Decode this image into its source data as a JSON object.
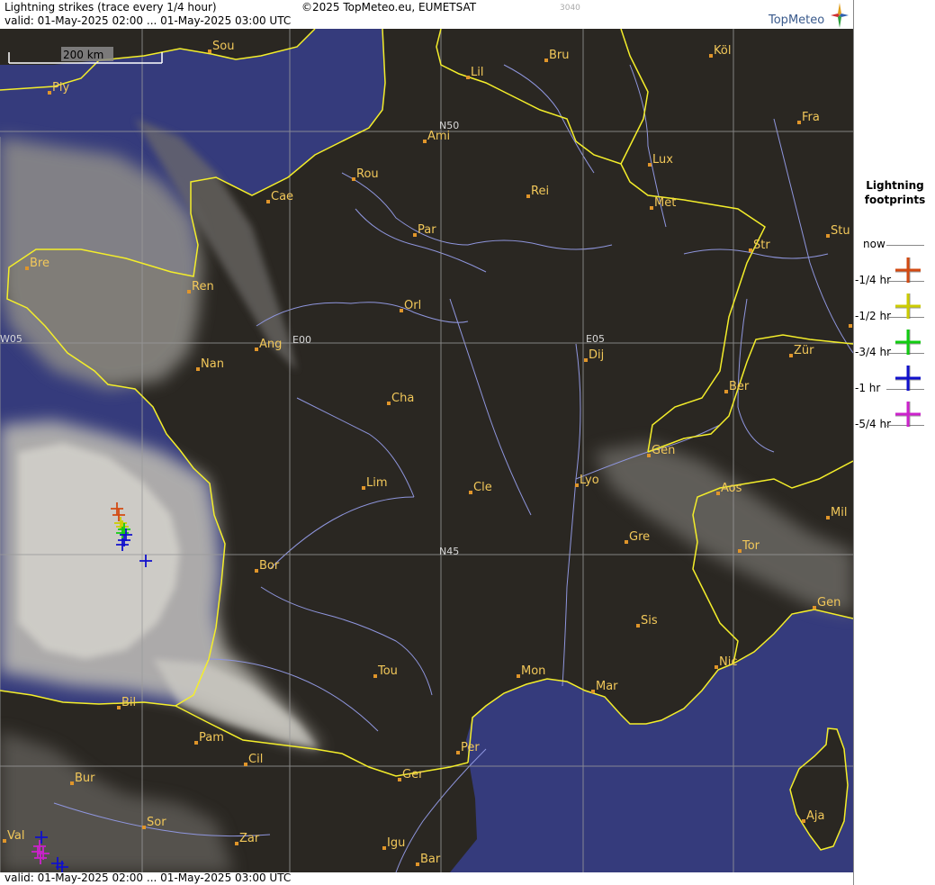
{
  "header": {
    "title": "Lightning strikes (trace every 1/4 hour)",
    "validity": "valid:  01-May-2025 02:00 ... 01-May-2025 03:00 UTC",
    "copyright": "©2025 TopMeteo.eu, EUMETSAT",
    "image_code": "3040",
    "brand": "TopMeteo"
  },
  "footer": {
    "validity": "valid:  01-May-2025 02:00 ... 01-May-2025 03:00 UTC"
  },
  "map": {
    "scale_label": "200 km",
    "grid_labels": [
      "N50",
      "N45",
      "E00",
      "E05",
      "W05"
    ],
    "cities": [
      "Sou",
      "Lil",
      "Bru",
      "Köl",
      "Ply",
      "Ami",
      "Fra",
      "Rou",
      "Lux",
      "Cae",
      "Rei",
      "Met",
      "Par",
      "Stu",
      "Str",
      "Bre",
      "Ren",
      "Orl",
      "F",
      "Ang",
      "Dij",
      "Zür",
      "Nan",
      "Ber",
      "Cha",
      "Gen",
      "Lim",
      "Cle",
      "Lyo",
      "Aos",
      "Mil",
      "Gre",
      "Tor",
      "Bor",
      "Gen",
      "Sis",
      "Nic",
      "Tou",
      "Mon",
      "Mar",
      "Bil",
      "Pam",
      "Cil",
      "Per",
      "Bur",
      "Ger",
      "Aja",
      "Sor",
      "Val",
      "Zar",
      "Igu",
      "Bar"
    ]
  },
  "legend": {
    "title_line1": "Lightning",
    "title_line2": "footprints",
    "entries": [
      {
        "label": "now",
        "color": null
      },
      {
        "label": "-1/4 hr",
        "color": "#d24a12"
      },
      {
        "label": "-1/2 hr",
        "color": "#cccc00"
      },
      {
        "label": "-3/4 hr",
        "color": "#11cc11"
      },
      {
        "label": "-1 hr",
        "color": "#1010cc"
      },
      {
        "label": "-5/4 hr",
        "color": "#cc22cc"
      }
    ]
  },
  "colors": {
    "sea": "#353b7c",
    "land": "#22201c",
    "border": "#f4ee2a",
    "river": "#8f96de",
    "grid": "#9a9a9a",
    "city_marker": "#e0952a",
    "city_label": "#f2c85a"
  }
}
